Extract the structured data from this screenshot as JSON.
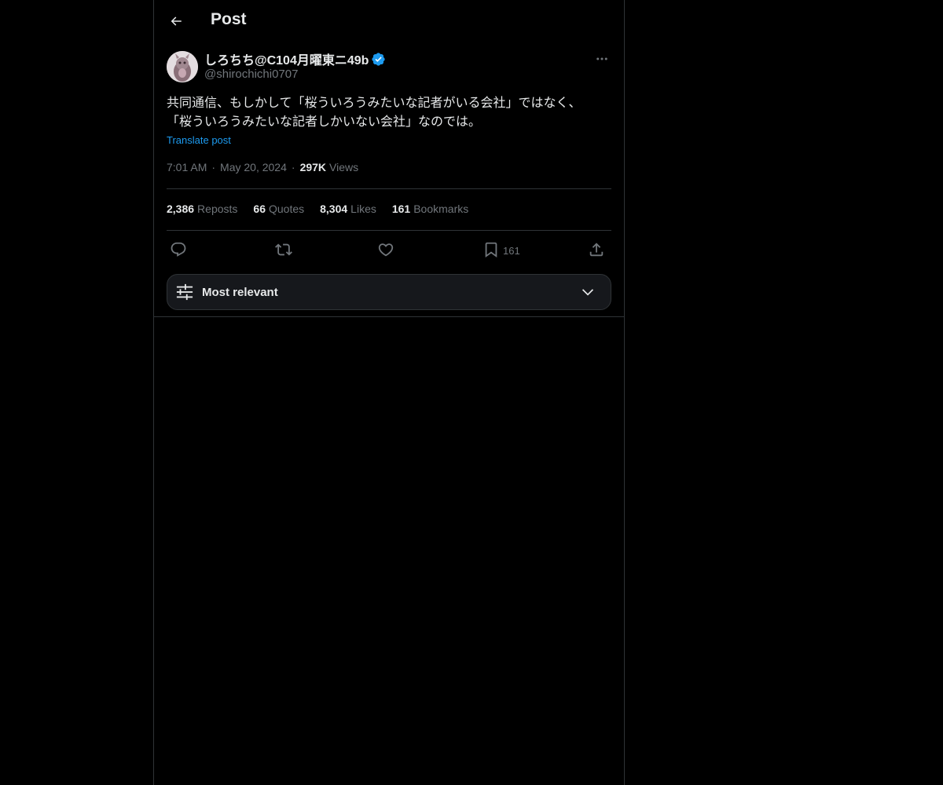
{
  "header": {
    "title": "Post",
    "back_icon": "arrow-left-icon"
  },
  "author": {
    "display_name": "しろちち@C104月曜東ニ49b",
    "handle": "@shirochichi0707",
    "verified": true,
    "verified_color": "#1d9bf0"
  },
  "post": {
    "text": "共同通信、もしかして「桜ういろうみたいな記者がいる会社」ではなく、\n「桜ういろうみたいな記者しかいない会社」なのでは。",
    "translate_label": "Translate post"
  },
  "meta": {
    "time": "7:01 AM",
    "separator": "·",
    "date": "May 20, 2024",
    "views_count": "297K",
    "views_label": "Views"
  },
  "stats": {
    "reposts": {
      "count": "2,386",
      "label": "Reposts"
    },
    "quotes": {
      "count": "66",
      "label": "Quotes"
    },
    "likes": {
      "count": "8,304",
      "label": "Likes"
    },
    "bookmarks": {
      "count": "161",
      "label": "Bookmarks"
    }
  },
  "actions": {
    "reply_icon": "reply-icon",
    "repost_icon": "repost-icon",
    "like_icon": "heart-icon",
    "bookmark_icon": "bookmark-icon",
    "bookmark_count": "161",
    "share_icon": "share-icon"
  },
  "sort": {
    "label": "Most relevant",
    "icon": "sliders-icon",
    "chevron": "chevron-down-icon"
  },
  "colors": {
    "background": "#000000",
    "text": "#e7e9ea",
    "secondary": "#71767b",
    "accent": "#1d9bf0",
    "border": "#2f3336"
  }
}
